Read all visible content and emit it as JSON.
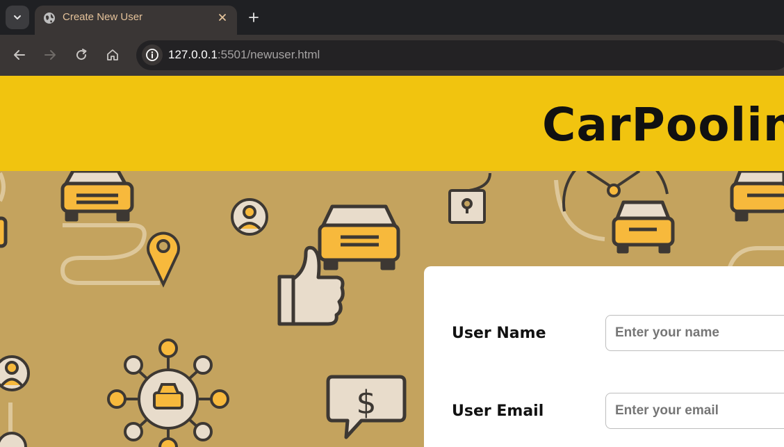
{
  "browser": {
    "tab_title": "Create New User",
    "url_host": "127.0.0.1",
    "url_rest": ":5501/newuser.html",
    "accent_color": "#e4c29a"
  },
  "page": {
    "site_title": "CarPooling",
    "header_color": "#f1c40f",
    "background_color": "#c4a35e",
    "form": {
      "name_label": "User Name",
      "name_placeholder": "Enter your name",
      "email_label": "User Email",
      "email_placeholder": "Enter your email"
    }
  }
}
